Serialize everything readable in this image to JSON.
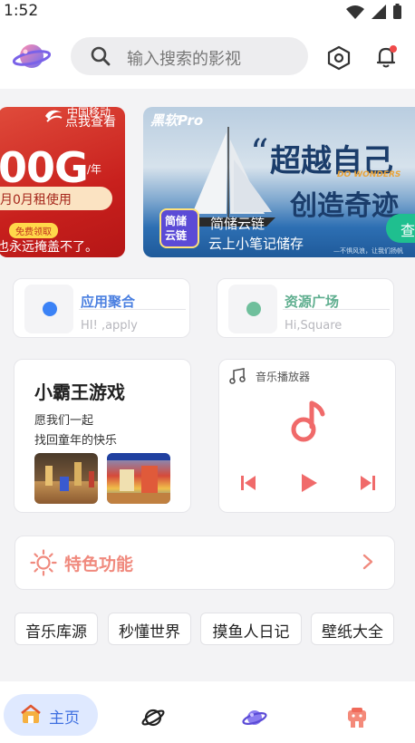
{
  "status_bar": {
    "time": "1:52"
  },
  "header": {
    "search_placeholder": "输入搜索的影视"
  },
  "banners": {
    "left": {
      "brand": "中国移动",
      "corner_text": "点我查看",
      "big_value": "00G",
      "per": "/年",
      "rent_text": "月0月租使用",
      "free_badge": "免费领取",
      "tagline": "也永远掩盖不了。"
    },
    "right": {
      "brand": "黑软Pro",
      "slogan_line1": "超越自己",
      "slogan_line2": "创造奇迹",
      "slogan_en": "DO WONDERS",
      "icon_text_1": "简储",
      "icon_text_2": "云链",
      "app_name": "简储云链",
      "app_subtitle": "云上小笔记储存",
      "check_button": "查",
      "fine_print": "—不惧风浪，让我们扬帆"
    }
  },
  "quick_cards": [
    {
      "title": "应用聚合",
      "subtitle": "HI! ,apply",
      "title_color": "#4a7fe0",
      "dot_color": "#3b82f6"
    },
    {
      "title": "资源广场",
      "subtitle": "Hi,Square",
      "title_color": "#5fae8f",
      "dot_color": "#6fbf9c"
    }
  ],
  "game_card": {
    "title": "小霸王游戏",
    "line1": "愿我们一起",
    "line2": "找回童年的快乐"
  },
  "music_card": {
    "title": "音乐播放器",
    "accent": "#f06a6a"
  },
  "feature": {
    "label": "特色功能",
    "color": "#f08a7e"
  },
  "tags": [
    "音乐库源",
    "秒懂世界",
    "摸鱼人日记",
    "壁纸大全"
  ],
  "bottom_nav": {
    "home_label": "主页",
    "items": [
      "home",
      "planet",
      "galaxy",
      "profile"
    ]
  }
}
